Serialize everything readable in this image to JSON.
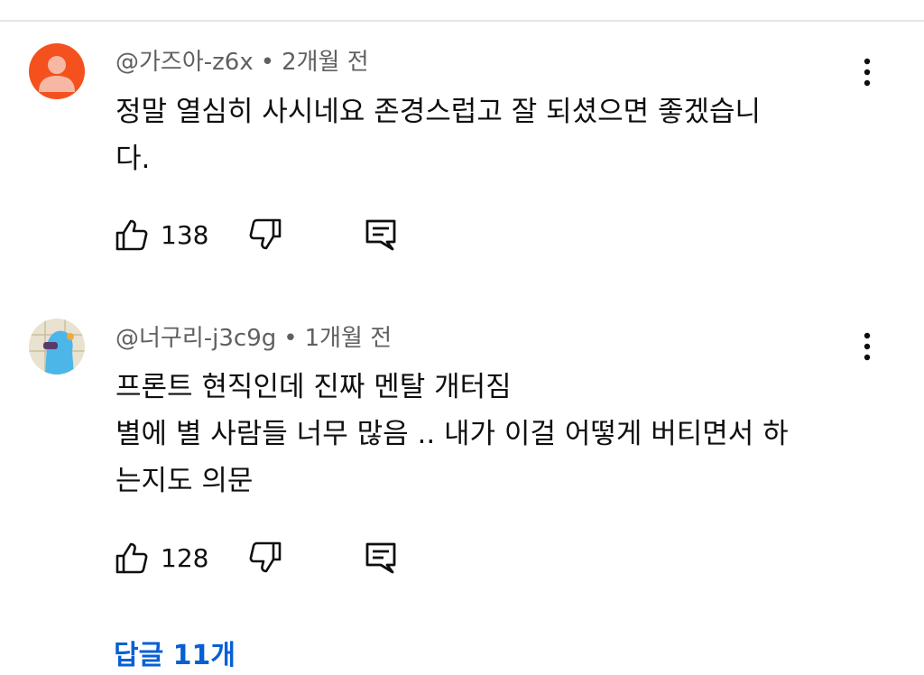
{
  "comments": [
    {
      "author": "@가즈아-z6x",
      "separator": "•",
      "time": "2개월 전",
      "lines": [
        "정말 열심히 사시네요 존경스럽고 잘 되셨으면 좋겠습니",
        "다."
      ],
      "likes": "138",
      "avatar_color": "#f4511e"
    },
    {
      "author": "@너구리-j3c9g",
      "separator": "•",
      "time": "1개월 전",
      "lines": [
        "프론트 현직인데 진짜 멘탈 개터짐",
        "별에 별 사람들 너무 많음 .. 내가 이걸 어떻게 버티면서 하",
        "는지도 의문"
      ],
      "likes": "128",
      "avatar_color": "#4db6e8"
    }
  ],
  "replies_label": "답글 11개",
  "accent_color": "#065fd4",
  "icons": [
    "like-icon",
    "dislike-icon",
    "reply-icon",
    "more-options-icon"
  ]
}
